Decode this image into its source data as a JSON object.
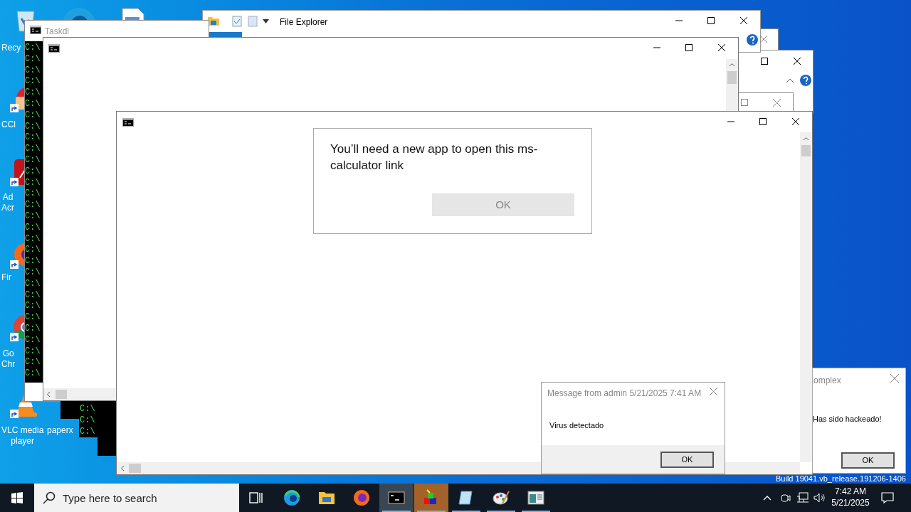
{
  "desktop_icons": [
    {
      "kind": "recycle",
      "lines": [
        "Recy"
      ]
    },
    {
      "kind": "ccleaner",
      "lines": [
        "CCl"
      ]
    },
    {
      "kind": "acrobat",
      "lines": [
        "Ad",
        "Acr"
      ]
    },
    {
      "kind": "firefox",
      "lines": [
        "Fir"
      ]
    },
    {
      "kind": "chrome",
      "lines": [
        "Go",
        "Chr"
      ]
    },
    {
      "kind": "vlc",
      "lines": [
        "VLC media",
        "player"
      ]
    },
    {
      "kind": "none",
      "lines": [
        "paperx"
      ]
    }
  ],
  "taskdl_window": {
    "title": "Taskdl",
    "console_lines": [
      "C:\\",
      "C:\\",
      "C:\\",
      "C:\\",
      "C:\\",
      "C:\\",
      "C:\\",
      "C:\\",
      "C:\\",
      "C:\\",
      "C:\\",
      "C:\\",
      "C:\\",
      "C:\\",
      "C:\\",
      "C:\\",
      "C:\\",
      "C:\\",
      "C:\\",
      "C:\\",
      "C:\\",
      "C:\\",
      "C:\\",
      "C:\\",
      "C:\\",
      "C:\\",
      "C:\\",
      "C:\\",
      "C:\\",
      "C:\\"
    ]
  },
  "small_console": {
    "console_lines": [
      "C:\\",
      "C:\\",
      "C:\\"
    ]
  },
  "file_explorer": {
    "title": "File Explorer"
  },
  "app_dialog": {
    "message": "You’ll need a new app to open this ms-calculator link",
    "button": "OK",
    "disabled": true
  },
  "message_box": {
    "title": "Message from admin 5/21/2025 7:41 AM",
    "message": "Virus detectado",
    "button": "OK"
  },
  "hack_box": {
    "title": "omplex",
    "message": "Has sido hackeado!",
    "button": "OK"
  },
  "build_text": "Build 19041.vb_release.191206-1406",
  "taskbar": {
    "search_placeholder": "Type here to search",
    "apps": [
      {
        "kind": "edge",
        "selected": false,
        "flashing": false,
        "running": false
      },
      {
        "kind": "explorer",
        "selected": false,
        "flashing": false,
        "running": false
      },
      {
        "kind": "firefox",
        "selected": false,
        "flashing": false,
        "running": false
      },
      {
        "kind": "console",
        "selected": true,
        "flashing": false,
        "running": true
      },
      {
        "kind": "cubes",
        "selected": false,
        "flashing": true,
        "running": true
      },
      {
        "kind": "notepad",
        "selected": false,
        "flashing": false,
        "running": true
      },
      {
        "kind": "paint",
        "selected": false,
        "flashing": false,
        "running": true
      },
      {
        "kind": "window",
        "selected": false,
        "flashing": false,
        "running": true
      }
    ],
    "time": "7:42 AM",
    "date": "5/21/2025"
  }
}
